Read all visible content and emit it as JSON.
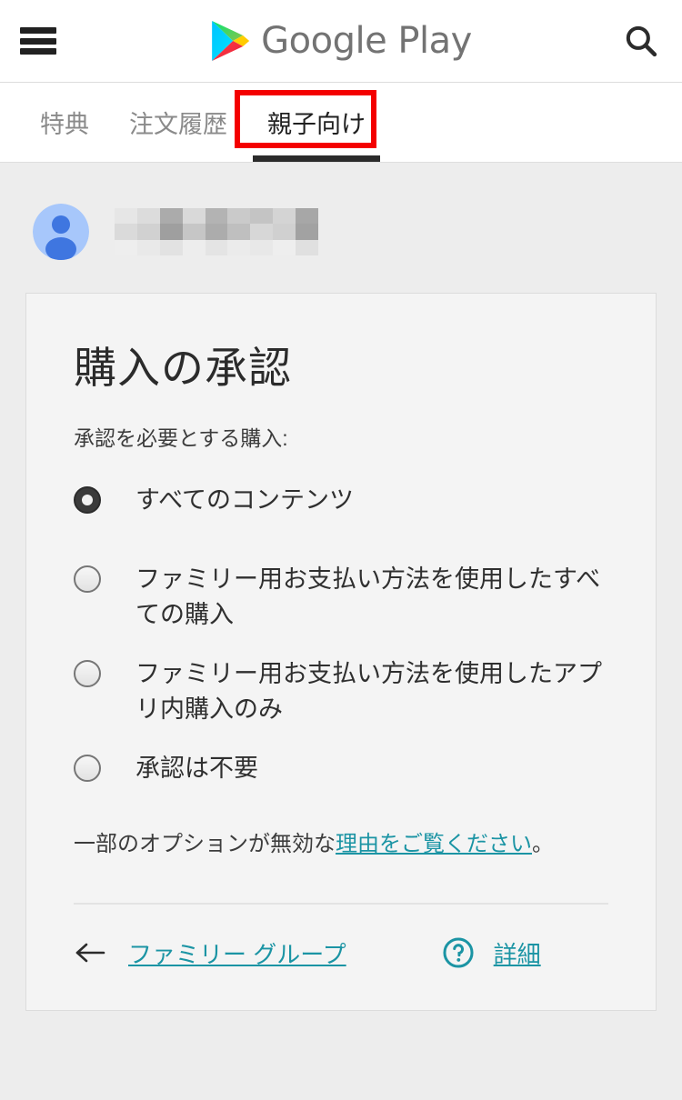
{
  "appbar": {
    "menu_icon": "hamburger-menu-icon",
    "brand_text": "Google Play",
    "logo_icon": "google-play-logo",
    "search_icon": "search-icon"
  },
  "tabs": [
    {
      "label": "特典",
      "active": false
    },
    {
      "label": "注文履歴",
      "active": false
    },
    {
      "label": "親子向け",
      "active": true
    }
  ],
  "account": {
    "avatar_icon": "account-avatar-icon",
    "name": ""
  },
  "card": {
    "title": "購入の承認",
    "subtitle": "承認を必要とする購入:",
    "options": [
      {
        "label": "すべてのコンテンツ",
        "selected": true
      },
      {
        "label": "ファミリー用お支払い方法を使用したすべての購入",
        "selected": false
      },
      {
        "label": "ファミリー用お支払い方法を使用したアプリ内購入のみ",
        "selected": false
      },
      {
        "label": "承認は不要",
        "selected": false
      }
    ],
    "note_prefix": "一部のオプションが無効な",
    "note_link": "理由をご覧ください",
    "note_suffix": "。",
    "footer": {
      "back_icon": "arrow-left-icon",
      "family_group_link": "ファミリー グループ",
      "help_icon": "help-circle-icon",
      "details_link": "詳細"
    }
  },
  "colors": {
    "link_teal": "#1b94a4",
    "highlight_red": "#f40000",
    "page_bg": "#ededed",
    "card_bg": "#f4f4f4"
  }
}
